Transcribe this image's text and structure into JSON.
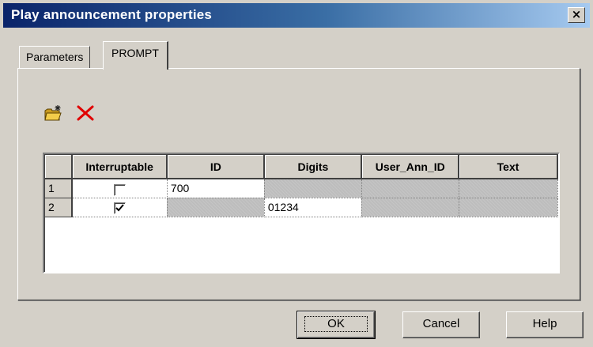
{
  "window": {
    "title": "Play announcement properties",
    "close_label": "×"
  },
  "tabs": [
    {
      "label": "Parameters",
      "active": false
    },
    {
      "label": "PROMPT",
      "active": true
    }
  ],
  "toolbar": {
    "new_icon": "new-folder-icon",
    "delete_icon": "delete-x-icon"
  },
  "grid": {
    "columns": [
      "",
      "Interruptable",
      "ID",
      "Digits",
      "User_Ann_ID",
      "Text"
    ],
    "rows": [
      {
        "num": "1",
        "interruptable": false,
        "id": "700",
        "digits": "",
        "user_ann_id": "",
        "text": ""
      },
      {
        "num": "2",
        "interruptable": true,
        "id": "",
        "digits": "01234",
        "user_ann_id": "",
        "text": ""
      }
    ]
  },
  "buttons": {
    "ok": "OK",
    "cancel": "Cancel",
    "help": "Help"
  },
  "colors": {
    "title_start": "#0a246a",
    "title_end": "#a6caf0",
    "face": "#d4d0c8",
    "disabled_cell": "#bdbdbd",
    "delete_icon": "#e00000"
  }
}
